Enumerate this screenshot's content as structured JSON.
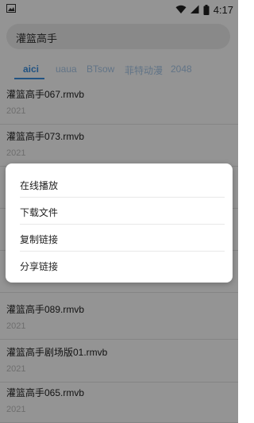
{
  "status_bar": {
    "time": "4:17",
    "icons": [
      "image-icon",
      "wifi-icon",
      "signal-icon",
      "battery-icon"
    ]
  },
  "search": {
    "query": "灌篮高手"
  },
  "tabs": [
    {
      "label": "aici",
      "active": true
    },
    {
      "label": "uaua",
      "active": false
    },
    {
      "label": "BTsow",
      "active": false
    },
    {
      "label": "菲特动漫",
      "active": false
    },
    {
      "label": "2048",
      "active": false
    }
  ],
  "results": [
    {
      "name": "灌篮高手067.rmvb",
      "year": "2021"
    },
    {
      "name": "灌篮高手073.rmvb",
      "year": "2021"
    },
    {
      "name": "",
      "year": ""
    },
    {
      "name": "",
      "year": ""
    },
    {
      "name": "",
      "year": ""
    },
    {
      "name": "灌篮高手089.rmvb",
      "year": "2021"
    },
    {
      "name": "灌篮高手剧场版01.rmvb",
      "year": "2021"
    },
    {
      "name": "灌篮高手065.rmvb",
      "year": "2021"
    }
  ],
  "context_menu": {
    "items": [
      {
        "label": "在线播放"
      },
      {
        "label": "下载文件"
      },
      {
        "label": "复制链接"
      },
      {
        "label": "分享链接"
      }
    ]
  },
  "colors": {
    "accent": "#3b8fe0",
    "tab_inactive": "#a9c9e8",
    "overlay": "rgba(0,0,0,0.42)"
  }
}
